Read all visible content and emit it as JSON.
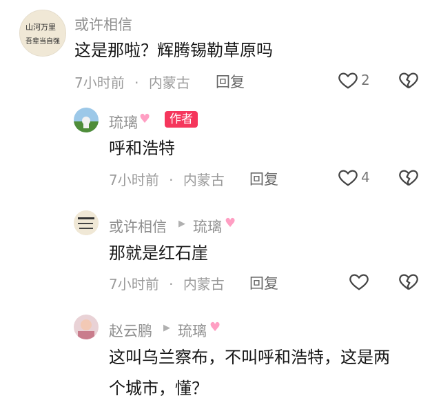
{
  "comments": [
    {
      "user": "或许相信",
      "text": "这是那啦？辉腾锡勒草原吗",
      "time": "7小时前",
      "location": "内蒙古",
      "reply_label": "回复",
      "likes": "2"
    },
    {
      "user": "琉璃",
      "badge": "作者",
      "text": "呼和浩特",
      "time": "7小时前",
      "location": "内蒙古",
      "reply_label": "回复",
      "likes": "4"
    },
    {
      "user": "或许相信",
      "reply_to": "琉璃",
      "text": "那就是红石崖",
      "time": "7小时前",
      "location": "内蒙古",
      "reply_label": "回复",
      "likes": ""
    },
    {
      "user": "赵云鹏",
      "reply_to": "琉璃",
      "text_line1": "这叫乌兰察布，不叫呼和浩特，这是两",
      "text_line2": "个城市，懂？"
    }
  ],
  "avatar_calligraphy": {
    "col1": "山河万里",
    "col2": "吾辈当自强"
  },
  "separator": "·",
  "icons": {
    "like": "heart-outline-icon",
    "dislike": "broken-heart-icon",
    "reply_arrow": "triangle-right-icon",
    "name_decoration": "pink-heart-icon"
  },
  "colors": {
    "badge": "#f5365c",
    "meta": "#9b9b9b",
    "text": "#161616"
  }
}
